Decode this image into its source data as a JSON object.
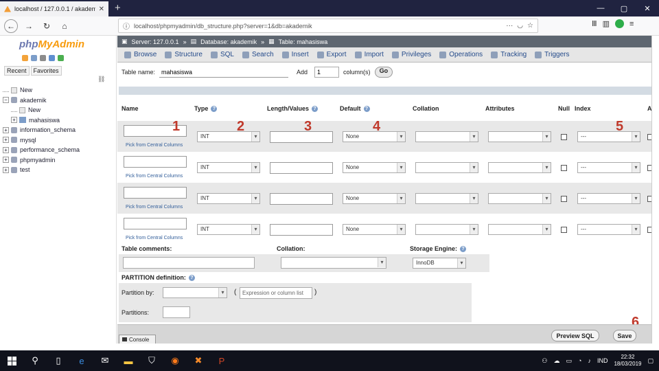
{
  "browser": {
    "tab_title": "localhost / 127.0.0.1 / akademik",
    "url": "localhost/phpmyadmin/db_structure.php?server=1&db=akademik"
  },
  "left_panel": {
    "logo_text_a": "php",
    "logo_text_b": "MyAdmin",
    "recent_label": "Recent",
    "favorites_label": "Favorites",
    "tree": [
      {
        "label": "New",
        "level": 0,
        "kind": "new"
      },
      {
        "label": "akademik",
        "level": 0,
        "kind": "db-open"
      },
      {
        "label": "New",
        "level": 1,
        "kind": "new"
      },
      {
        "label": "mahasiswa",
        "level": 1,
        "kind": "table"
      },
      {
        "label": "information_schema",
        "level": 0,
        "kind": "db"
      },
      {
        "label": "mysql",
        "level": 0,
        "kind": "db"
      },
      {
        "label": "performance_schema",
        "level": 0,
        "kind": "db"
      },
      {
        "label": "phpmyadmin",
        "level": 0,
        "kind": "db"
      },
      {
        "label": "test",
        "level": 0,
        "kind": "db"
      }
    ]
  },
  "breadcrumb": {
    "server": "Server: 127.0.0.1",
    "database": "Database: akademik",
    "table": "Table: mahasiswa"
  },
  "menu": [
    "Browse",
    "Structure",
    "SQL",
    "Search",
    "Insert",
    "Export",
    "Import",
    "Privileges",
    "Operations",
    "Tracking",
    "Triggers"
  ],
  "form": {
    "table_name_label": "Table name:",
    "table_name_value": "mahasiswa",
    "add_label": "Add",
    "add_value": "1",
    "columns_label": "column(s)",
    "go_label": "Go"
  },
  "columns": {
    "name": "Name",
    "type": "Type",
    "length": "Length/Values",
    "default": "Default",
    "collation": "Collation",
    "attributes": "Attributes",
    "null": "Null",
    "index": "Index",
    "ai": "A"
  },
  "rows": [
    {
      "type": "INT",
      "default": "None",
      "index": "---",
      "pick": "Pick from Central Columns"
    },
    {
      "type": "INT",
      "default": "None",
      "index": "---",
      "pick": "Pick from Central Columns"
    },
    {
      "type": "INT",
      "default": "None",
      "index": "---",
      "pick": "Pick from Central Columns"
    },
    {
      "type": "INT",
      "default": "None",
      "index": "---",
      "pick": "Pick from Central Columns"
    }
  ],
  "annotations": [
    "1",
    "2",
    "3",
    "4",
    "5",
    "6"
  ],
  "lower": {
    "table_comments": "Table comments:",
    "collation": "Collation:",
    "storage_engine": "Storage Engine:",
    "storage_engine_value": "InnoDB",
    "partition_def": "PARTITION definition:",
    "partition_by": "Partition by:",
    "expression_placeholder": "Expression or column list",
    "partitions": "Partitions:"
  },
  "footer": {
    "console": "Console",
    "preview_sql": "Preview SQL",
    "save": "Save"
  },
  "taskbar": {
    "lang": "IND",
    "time": "22:32",
    "date": "18/03/2019"
  }
}
